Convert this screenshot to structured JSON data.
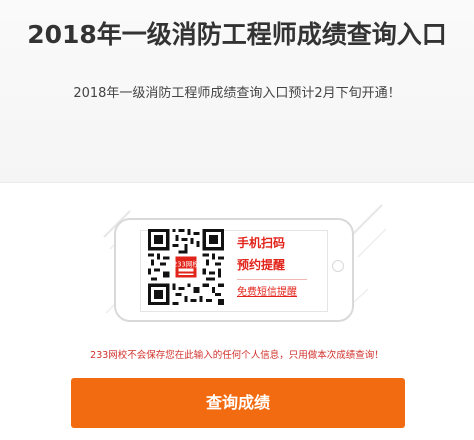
{
  "header": {
    "title": "2018年一级消防工程师成绩查询入口",
    "subtitle": "2018年一级消防工程师成绩查询入口预计2月下旬开通！"
  },
  "qr_card": {
    "logo_text": "233网校",
    "line1": "手机扫码",
    "line2": "预约提醒",
    "link": "免费短信提醒"
  },
  "notice": "233网校不会保存您在此输入的任何个人信息，只用做本次成绩查询！",
  "button": {
    "label": "查询成绩"
  },
  "colors": {
    "accent_red": "#e2231a",
    "button_orange": "#f26b10",
    "title": "#333333"
  }
}
